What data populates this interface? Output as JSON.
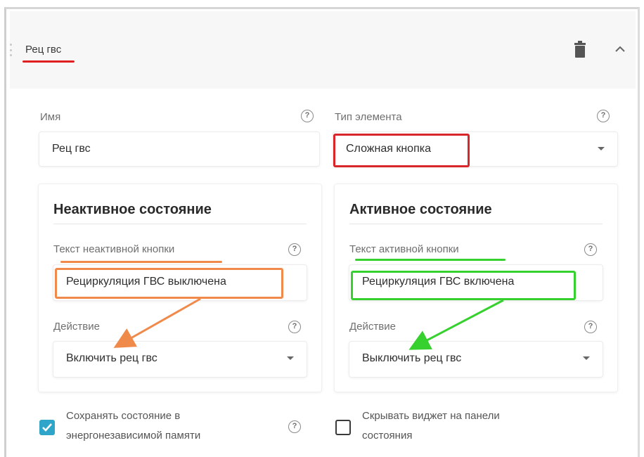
{
  "card": {
    "title": "Рец гвс"
  },
  "form": {
    "name_label": "Имя",
    "name_value": "Рец гвс",
    "type_label": "Тип элемента",
    "type_value": "Сложная кнопка"
  },
  "inactive": {
    "heading": "Неактивное состояние",
    "text_label": "Текст неактивной кнопки",
    "text_value": "Рециркуляция ГВС выключена",
    "action_label": "Действие",
    "action_value": "Включить рец гвс"
  },
  "active": {
    "heading": "Активное состояние",
    "text_label": "Текст активной кнопки",
    "text_value": "Рециркуляция ГВС включена",
    "action_label": "Действие",
    "action_value": "Выключить рец гвс"
  },
  "options": {
    "save_state_line1": "Сохранять состояние в",
    "save_state_line2": "энергонезависимой памяти",
    "save_state_checked": true,
    "hide_widget_line1": "Скрывать виджет на панели",
    "hide_widget_line2": "состояния",
    "hide_widget_checked": false
  },
  "help_glyph": "?",
  "colors": {
    "title_underline": "#e02020",
    "type_highlight": "#d9262b",
    "inactive_highlight": "#f08a4b",
    "active_highlight": "#36d12e",
    "checkbox_accent": "#2fa6c9"
  },
  "icons": [
    "trash-icon",
    "chevron-up-icon",
    "help-icon",
    "dropdown-caret-icon",
    "drag-handle-icon"
  ]
}
